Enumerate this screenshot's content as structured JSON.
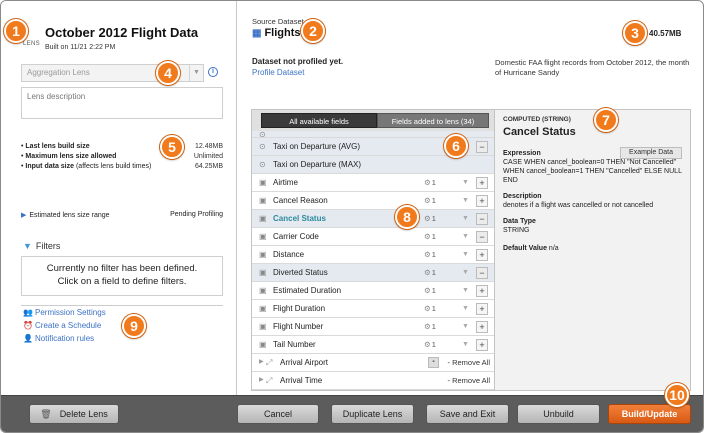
{
  "lens": {
    "tag": "LENS",
    "title": "October 2012 Flight Data",
    "built_on": "Built on 11/21 2:22 PM",
    "aggregation_placeholder": "Aggregation Lens",
    "description_placeholder": "Lens description",
    "stats": [
      {
        "label": "Last lens build size",
        "note": "",
        "value": "12.48MB"
      },
      {
        "label": "Maximum lens size allowed",
        "note": "",
        "value": "Unlimited"
      },
      {
        "label": "Input data size",
        "note": " (affects lens build times)",
        "value": "64.25MB"
      }
    ],
    "estimated_label": "Estimated lens size range",
    "estimated_value": "Pending Profiling",
    "filters_label": "Filters",
    "filters_line1": "Currently no filter has been defined.",
    "filters_line2": "Click on a field to define filters.",
    "links": [
      "Permission Settings",
      "Create a Schedule",
      "Notification rules"
    ]
  },
  "source": {
    "label": "Source Dataset",
    "name": "Flights",
    "size": "40.57MB",
    "not_profiled": "Dataset not profiled yet.",
    "profile_link": "Profile Dataset",
    "description": "Domestic FAA flight records from October 2012, the month of Hurricane Sandy"
  },
  "field_tabs": {
    "all": "All available fields",
    "added": "Fields added to lens (34)"
  },
  "fields": [
    {
      "name": "Taxi on Departure (AVG)",
      "count": "",
      "action": "minus",
      "kind": "measure",
      "alt": true
    },
    {
      "name": "Taxi on Departure (MAX)",
      "count": "",
      "action": "",
      "kind": "measure",
      "alt": true
    },
    {
      "name": "Airtime",
      "count": "1",
      "action": "plus",
      "kind": "dimension",
      "alt": false
    },
    {
      "name": "Cancel Reason",
      "count": "1",
      "action": "plus",
      "kind": "dimension",
      "alt": false
    },
    {
      "name": "Cancel Status",
      "count": "1",
      "action": "minus",
      "kind": "dimension",
      "alt": true,
      "highlight": true
    },
    {
      "name": "Carrier Code",
      "count": "1",
      "action": "minus",
      "kind": "dimension",
      "alt": false
    },
    {
      "name": "Distance",
      "count": "1",
      "action": "plus",
      "kind": "dimension",
      "alt": false
    },
    {
      "name": "Diverted Status",
      "count": "1",
      "action": "minus",
      "kind": "dimension",
      "alt": true
    },
    {
      "name": "Estimated Duration",
      "count": "1",
      "action": "plus",
      "kind": "dimension",
      "alt": false
    },
    {
      "name": "Flight Duration",
      "count": "1",
      "action": "plus",
      "kind": "dimension",
      "alt": false
    },
    {
      "name": "Flight Number",
      "count": "1",
      "action": "plus",
      "kind": "dimension",
      "alt": false
    },
    {
      "name": "Tail Number",
      "count": "1",
      "action": "plus",
      "kind": "dimension",
      "alt": false
    },
    {
      "name": "Arrival Airport",
      "remove": "- Remove All",
      "kind": "reference",
      "alt": false
    },
    {
      "name": "Arrival Time",
      "remove": "- Remove All",
      "kind": "reference",
      "alt": false
    }
  ],
  "detail": {
    "computed": "COMPUTED (STRING)",
    "title": "Cancel Status",
    "expression_label": "Expression",
    "example_button": "Example Data",
    "expression": "CASE WHEN cancel_boolean=0 THEN \"Not Cancelled\" WHEN cancel_boolean=1 THEN \"Cancelled\" ELSE NULL END",
    "description_label": "Description",
    "description": "denotes if a flight was cancelled or not cancelled",
    "datatype_label": "Data Type",
    "datatype": "STRING",
    "default_label": "Default Value",
    "default_value": "n/a"
  },
  "buttons": {
    "delete": "Delete Lens",
    "cancel": "Cancel",
    "duplicate": "Duplicate Lens",
    "save_exit": "Save and Exit",
    "unbuild": "Unbuild",
    "build": "Build/Update"
  },
  "badges": [
    "1",
    "2",
    "3",
    "4",
    "5",
    "6",
    "7",
    "8",
    "9",
    "10"
  ],
  "colors": {
    "accent": "#f07a1c",
    "link": "#3b72c4",
    "highlight": "#2e8a9e"
  }
}
